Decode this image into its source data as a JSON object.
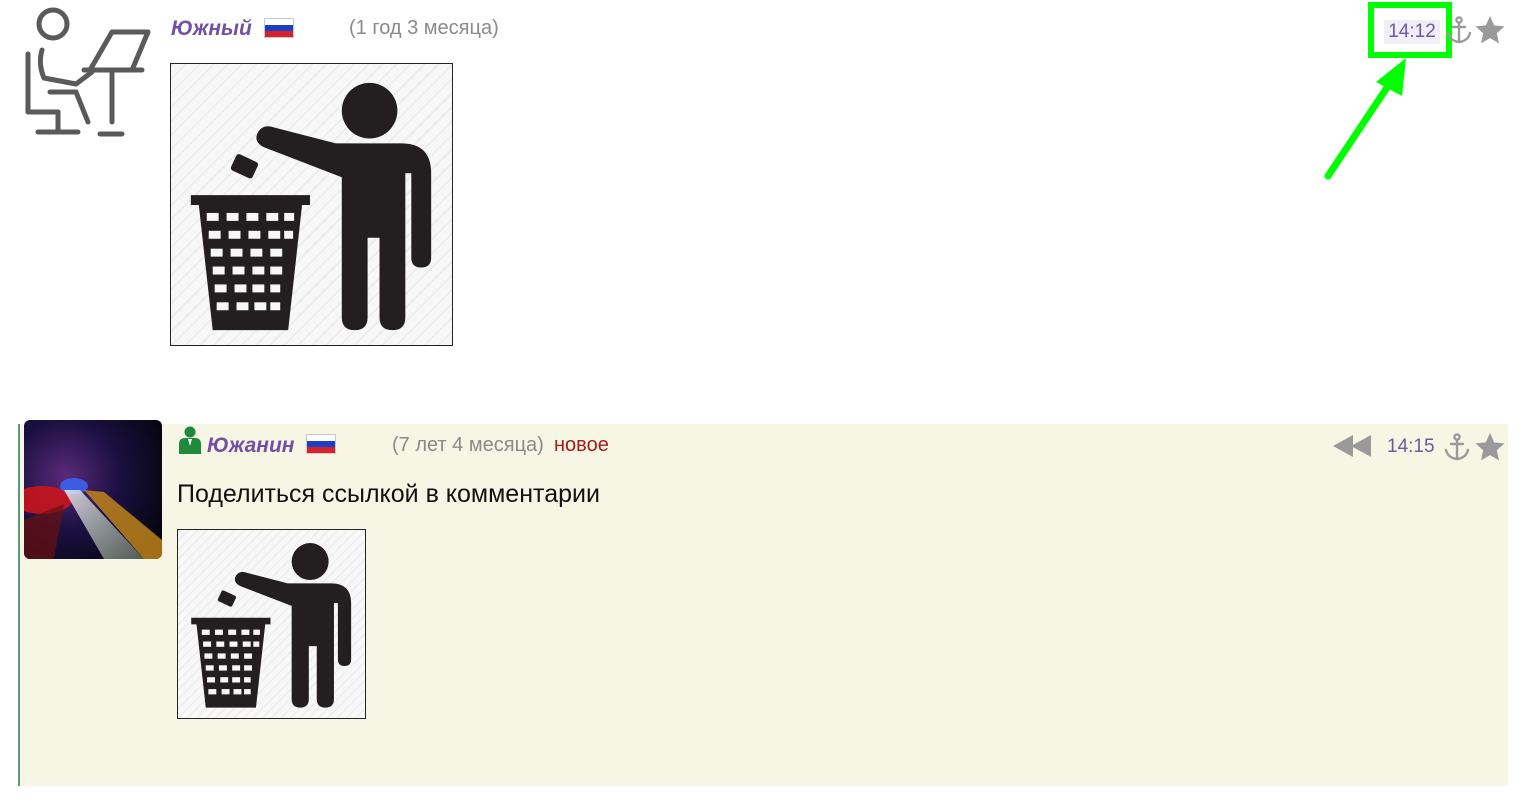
{
  "comments": [
    {
      "author": "Южный",
      "account_age": "(1 год 3 месяца)",
      "time": "14:12",
      "avatar_icon": "person-at-desk-icon",
      "image_icon": "litter-bin-person-icon",
      "flag": "russia",
      "highlight_color": "#00ff00"
    },
    {
      "author": "Южанин",
      "account_age": "(7 лет 4 месяца)",
      "new_label": "новое",
      "time": "14:15",
      "text": "Поделиться ссылкой в комментарии",
      "avatar_icon": "night-road-photo",
      "image_icon": "litter-bin-person-icon",
      "flag": "russia",
      "background_color": "#f7f5e3"
    }
  ],
  "colors": {
    "author": "#7251a3",
    "meta": "#8a8a8a",
    "new": "#a11d1d",
    "icon_gray": "#9a9a9a"
  }
}
